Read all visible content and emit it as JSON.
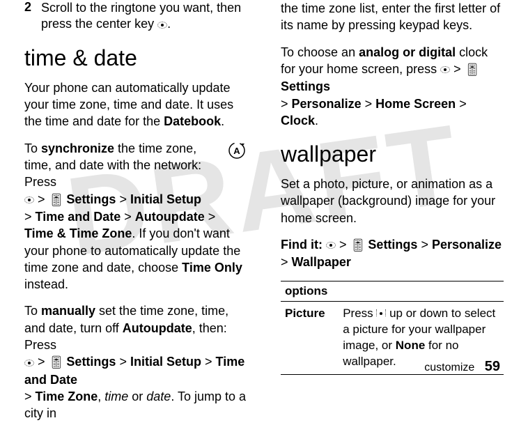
{
  "watermark": "DRAFT",
  "left": {
    "step_num": "2",
    "step_text_a": "Scroll to the ringtone you want, then press the center key ",
    "step_text_b": ".",
    "heading_time": "time & date",
    "para_intro_a": "Your phone can automatically update your time zone, time and date. It uses the time and date for the ",
    "para_intro_b": ".",
    "datebook": "Datebook",
    "sync_a": "To ",
    "sync_bold": "synchronize",
    "sync_b": " the time zone, time, and date with the network: Press ",
    "settings": "Settings",
    "initial_setup": "Initial Setup",
    "timedate": "Time and Date",
    "autoupdate": "Autoupdate",
    "timezone_opt": "Time & Time Zone",
    "sync_c": ". If you don't want your phone to automatically update the time zone and date, choose ",
    "timeonly": "Time Only",
    "sync_d": " instead.",
    "manual_a": "To ",
    "manual_bold": "manually",
    "manual_b": " set the time zone, time, and date, turn off ",
    "manual_c": ", then: Press ",
    "timezone": "Time Zone",
    "manual_d": ", ",
    "time_it": "time",
    "or": " or ",
    "date_it": "date",
    "manual_e": ". To jump to a city in ",
    "gt": ">"
  },
  "right": {
    "cont": "the time zone list, enter the first letter of its name by pressing keypad keys.",
    "analog_a": "To choose an ",
    "analog_bold": "analog or digital",
    "analog_b": " clock for your home screen, press ",
    "settings": "Settings",
    "personalize": "Personalize",
    "homescreen": "Home Screen",
    "clock": "Clock",
    "heading_wallpaper": "wallpaper",
    "wall_intro": "Set a photo, picture, or animation as a wallpaper (background) image for your home screen.",
    "findit": "Find it:",
    "wallpaper": "Wallpaper",
    "options_hdr": "options",
    "row_label": "Picture",
    "row_body_a": "Press ",
    "row_body_b": " up or down to select a picture for your wallpaper image, or ",
    "none": "None",
    "row_body_c": " for no wallpaper.",
    "gt": ">"
  },
  "footer": {
    "section": "customize",
    "page": "59"
  }
}
